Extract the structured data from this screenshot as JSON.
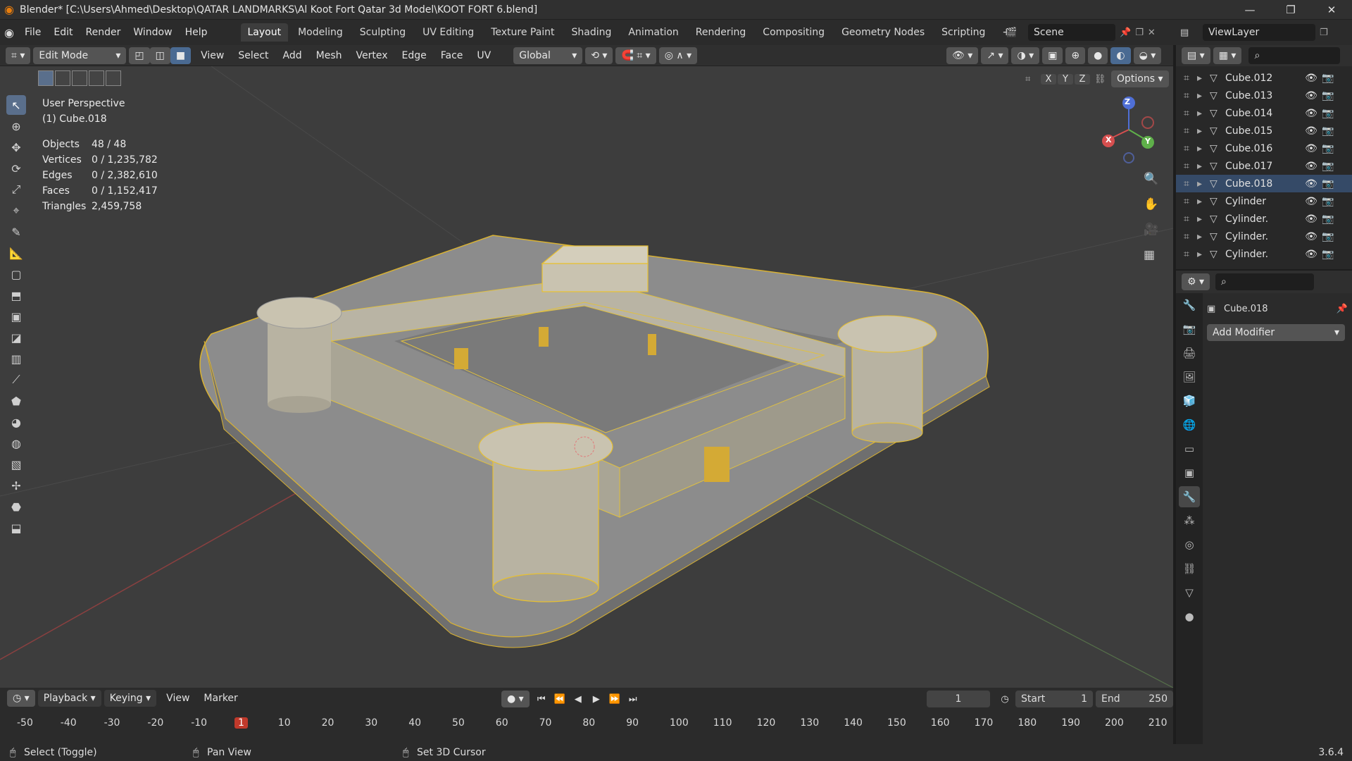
{
  "app": {
    "title": "Blender* [C:\\Users\\Ahmed\\Desktop\\QATAR LANDMARKS\\Al Koot Fort Qatar 3d Model\\KOOT FORT 6.blend]",
    "version": "3.6.4",
    "window_controls": [
      "—",
      "❐",
      "✕"
    ]
  },
  "menus": [
    "File",
    "Edit",
    "Render",
    "Window",
    "Help"
  ],
  "workspaces": [
    {
      "label": "Layout",
      "active": true
    },
    {
      "label": "Modeling"
    },
    {
      "label": "Sculpting"
    },
    {
      "label": "UV Editing"
    },
    {
      "label": "Texture Paint"
    },
    {
      "label": "Shading"
    },
    {
      "label": "Animation"
    },
    {
      "label": "Rendering"
    },
    {
      "label": "Compositing"
    },
    {
      "label": "Geometry Nodes"
    },
    {
      "label": "Scripting"
    }
  ],
  "add_workspace": "+",
  "scene": "Scene",
  "view_layer": "ViewLayer",
  "viewport_header": {
    "mode": "Edit Mode",
    "menus": [
      "View",
      "Select",
      "Add",
      "Mesh",
      "Vertex",
      "Edge",
      "Face",
      "UV"
    ],
    "orientation": "Global",
    "axes": [
      "X",
      "Y",
      "Z"
    ],
    "options_label": "Options"
  },
  "overlay": {
    "perspective": "User Perspective",
    "active_object": "(1) Cube.018",
    "stats": [
      {
        "label": "Objects",
        "value": "48 / 48"
      },
      {
        "label": "Vertices",
        "value": "0 / 1,235,782"
      },
      {
        "label": "Edges",
        "value": "0 / 2,382,610"
      },
      {
        "label": "Faces",
        "value": "0 / 1,152,417"
      },
      {
        "label": "Triangles",
        "value": "2,459,758"
      }
    ]
  },
  "gizmo": {
    "x": "X",
    "y": "Y",
    "z": "Z"
  },
  "outliner": {
    "items": [
      {
        "label": "Cube.012"
      },
      {
        "label": "Cube.013"
      },
      {
        "label": "Cube.014"
      },
      {
        "label": "Cube.015"
      },
      {
        "label": "Cube.016"
      },
      {
        "label": "Cube.017"
      },
      {
        "label": "Cube.018",
        "selected": true
      },
      {
        "label": "Cylinder"
      },
      {
        "label": "Cylinder."
      },
      {
        "label": "Cylinder."
      },
      {
        "label": "Cylinder."
      }
    ]
  },
  "properties": {
    "object_name": "Cube.018",
    "add_modifier": "Add Modifier"
  },
  "timeline": {
    "menus": [
      "Playback",
      "Keying",
      "View",
      "Marker"
    ],
    "current_frame": "1",
    "start_label": "Start",
    "start": "1",
    "end_label": "End",
    "end": "250",
    "ruler": [
      "-50",
      "-40",
      "-30",
      "-20",
      "-10",
      "1",
      "10",
      "20",
      "30",
      "40",
      "50",
      "60",
      "70",
      "80",
      "90",
      "100",
      "110",
      "120",
      "130",
      "140",
      "150",
      "160",
      "170",
      "180",
      "190",
      "200",
      "210"
    ]
  },
  "statusbar": {
    "left": "Select (Toggle)",
    "middle": "Pan View",
    "right": "Set 3D Cursor"
  },
  "colors": {
    "selection": "#f5c518",
    "active_tab": "#3d3d3d",
    "active_tool": "#5a6f8c",
    "outliner_selected": "#354a67",
    "frame_marker": "#c0392b"
  }
}
